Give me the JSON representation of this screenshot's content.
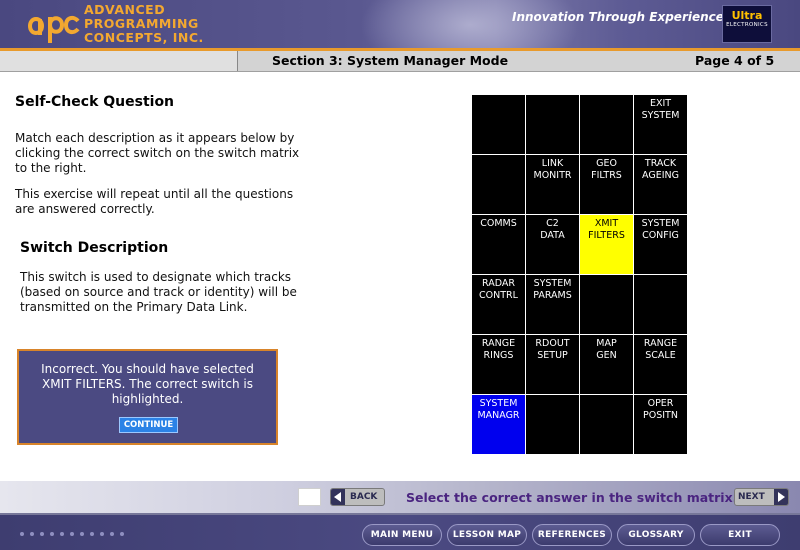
{
  "header": {
    "company_name_lines": [
      "ADVANCED",
      "PROGRAMMING",
      "CONCEPTS, INC."
    ],
    "tagline": "Innovation Through Experience",
    "partner_logo_main": "Ultra",
    "partner_logo_sub": "ELECTRONICS",
    "logo_icon": "apc-logo-icon"
  },
  "section_bar": {
    "title": "Section 3: System Manager Mode",
    "page_indicator": "Page 4 of 5"
  },
  "content": {
    "question_heading": "Self-Check Question",
    "instruction_1": "Match each description as it appears below by clicking the correct switch on the switch matrix to the right.",
    "instruction_2": "This exercise will repeat until all the questions are answered correctly.",
    "switch_heading": "Switch Description",
    "switch_description": "This switch is used to designate which tracks (based on source and track or identity) will be transmitted on the Primary Data Link."
  },
  "feedback": {
    "message": "Incorrect. You should have selected XMIT FILTERS. The correct switch is highlighted.",
    "continue_label": "CONTINUE"
  },
  "switch_matrix": {
    "rows": [
      [
        {
          "label": "",
          "state": "normal"
        },
        {
          "label": "",
          "state": "normal"
        },
        {
          "label": "",
          "state": "normal"
        },
        {
          "label": "EXIT\nSYSTEM",
          "state": "normal"
        }
      ],
      [
        {
          "label": "",
          "state": "normal"
        },
        {
          "label": "LINK\nMONITR",
          "state": "normal"
        },
        {
          "label": "GEO\nFILTRS",
          "state": "normal"
        },
        {
          "label": "TRACK\nAGEING",
          "state": "normal"
        }
      ],
      [
        {
          "label": "COMMS",
          "state": "normal"
        },
        {
          "label": "C2\nDATA",
          "state": "normal"
        },
        {
          "label": "XMIT\nFILTERS",
          "state": "correct"
        },
        {
          "label": "SYSTEM\nCONFIG",
          "state": "normal"
        }
      ],
      [
        {
          "label": "RADAR\nCONTRL",
          "state": "normal"
        },
        {
          "label": "SYSTEM\nPARAMS",
          "state": "normal"
        },
        {
          "label": "",
          "state": "normal"
        },
        {
          "label": "",
          "state": "normal"
        }
      ],
      [
        {
          "label": "RANGE\nRINGS",
          "state": "normal"
        },
        {
          "label": "RDOUT\nSETUP",
          "state": "normal"
        },
        {
          "label": "MAP\nGEN",
          "state": "normal"
        },
        {
          "label": "RANGE\nSCALE",
          "state": "normal"
        }
      ],
      [
        {
          "label": "SYSTEM\nMANAGR",
          "state": "selected"
        },
        {
          "label": "",
          "state": "normal"
        },
        {
          "label": "",
          "state": "normal"
        },
        {
          "label": "OPER\nPOSITN",
          "state": "normal"
        }
      ]
    ],
    "colors": {
      "normal": "#000000",
      "correct": "#ffff00",
      "selected": "#0000ee"
    }
  },
  "nav_bar": {
    "back_label": "BACK",
    "next_label": "NEXT",
    "instruction": "Select the correct answer in the switch matrix."
  },
  "footer": {
    "main_menu": "MAIN MENU",
    "lesson_map": "LESSON MAP",
    "references": "REFERENCES",
    "glossary": "GLOSSARY",
    "exit": "EXIT"
  },
  "colors": {
    "header_bg": "#4a4880",
    "accent_orange": "#e89a2c",
    "company_text": "#f3a830",
    "nav_instruction": "#4a2480",
    "continue_button": "#2b82e6"
  }
}
